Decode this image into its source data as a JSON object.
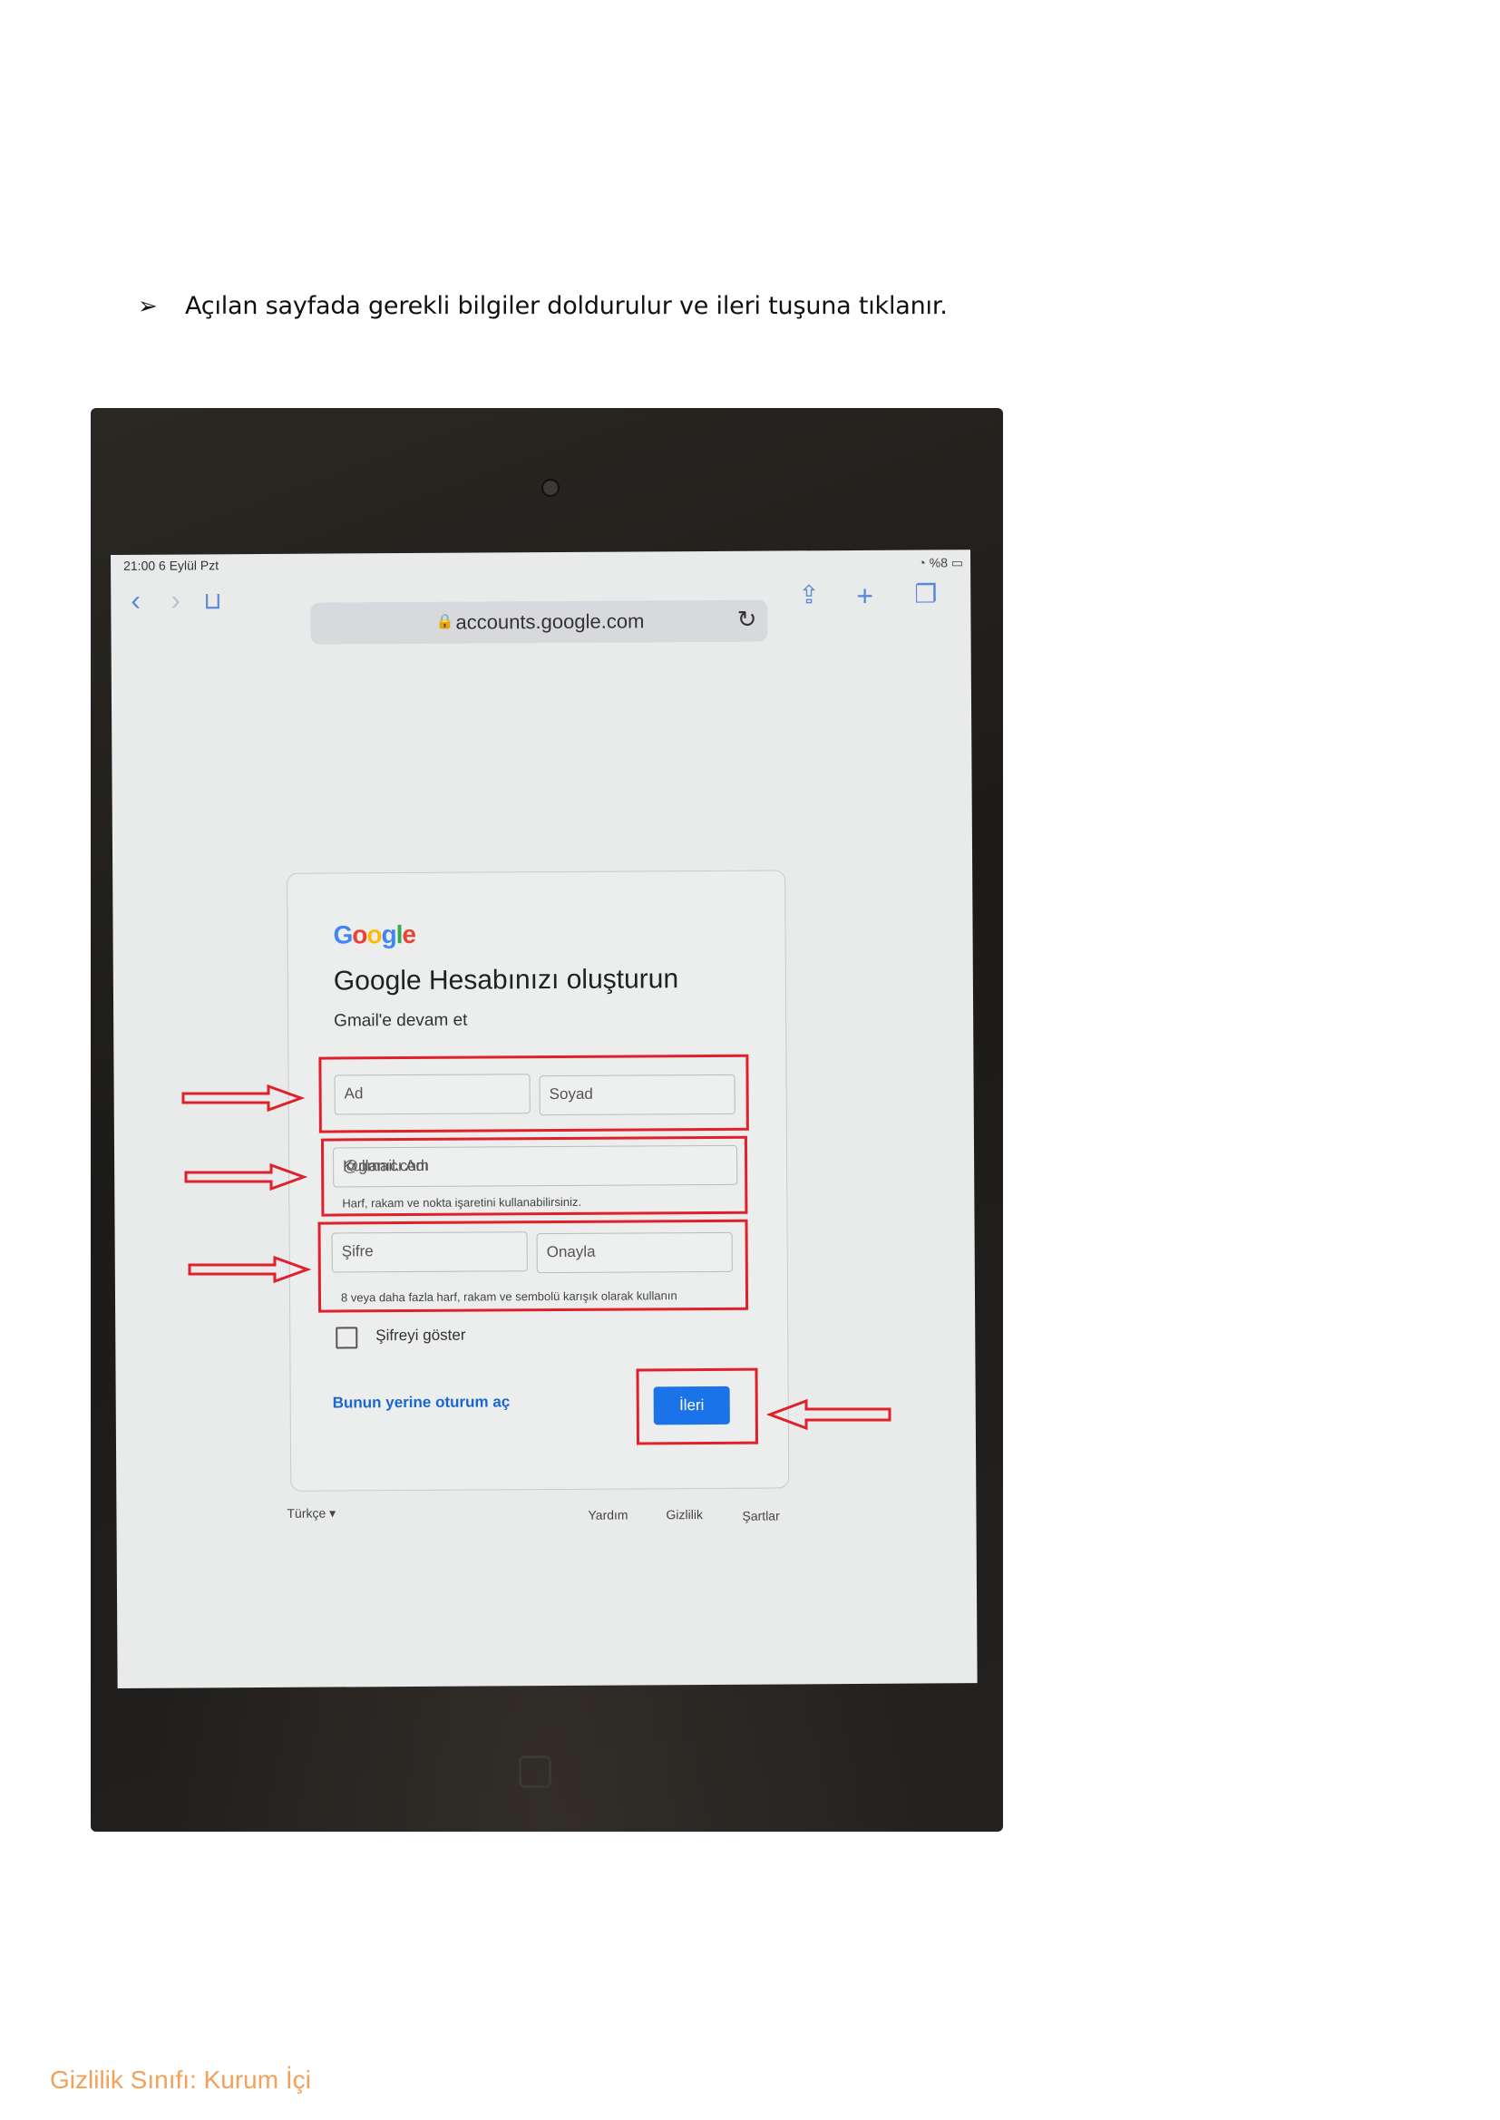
{
  "instruction": {
    "bullet": "➢",
    "text": "Açılan sayfada gerekli bilgiler doldurulur ve ileri tuşuna tıklanır."
  },
  "tablet": {
    "status_left": "21:00  6 Eylül Pzt",
    "status_right": "%8",
    "url": "accounts.google.com",
    "card": {
      "logo": "Google",
      "title": "Google Hesabınızı oluşturun",
      "subtitle": "Gmail'e devam et",
      "first_name_placeholder": "Ad",
      "last_name_placeholder": "Soyad",
      "username_placeholder": "Kullanıcı Adı",
      "username_suffix": "@gmail.com",
      "username_hint": "Harf, rakam ve nokta işaretini kullanabilirsiniz.",
      "password_placeholder": "Şifre",
      "confirm_placeholder": "Onayla",
      "password_hint": "8 veya daha fazla harf, rakam ve sembolü karışık olarak kullanın",
      "show_password_label": "Şifreyi göster",
      "signin_instead": "Bunun yerine oturum aç",
      "next_button": "İleri"
    },
    "footer": {
      "language": "Türkçe",
      "help": "Yardım",
      "privacy": "Gizlilik",
      "terms": "Şartlar"
    }
  },
  "colors": {
    "highlight": "#e0202a",
    "next_button": "#1a73e8",
    "classification": "#f2a15a"
  },
  "classification": "Gizlilik Sınıfı: Kurum İçi"
}
